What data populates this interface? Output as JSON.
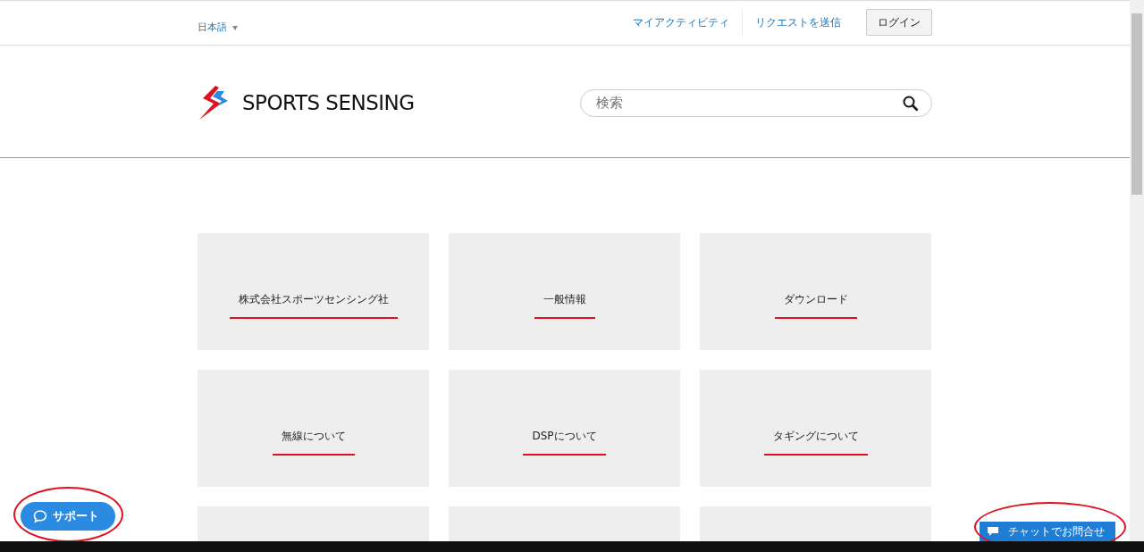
{
  "top_bar": {
    "language": "日本語",
    "links": [
      "マイアクティビティ",
      "リクエストを送信"
    ],
    "login_button": "ログイン"
  },
  "header": {
    "logo_text": "SPORTS SENSING",
    "search": {
      "placeholder": "検索"
    }
  },
  "tiles": [
    {
      "label": "株式会社スポーツセンシング社"
    },
    {
      "label": "一般情報"
    },
    {
      "label": "ダウンロード"
    },
    {
      "label": "無線について"
    },
    {
      "label": "DSPについて"
    },
    {
      "label": "タギングについて"
    }
  ],
  "support_button": "サポート",
  "chat_button": "チャットでお問合せ"
}
